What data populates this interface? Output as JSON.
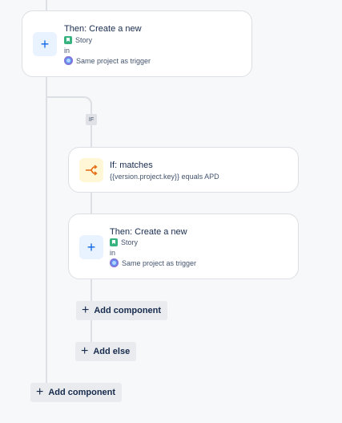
{
  "outer_then": {
    "title": "Then: Create a new",
    "issue_type": "Story",
    "in_label": "in",
    "project": "Same project as trigger"
  },
  "if_tag": "IF",
  "if_condition": {
    "title": "If: matches",
    "detail": "{{version.project.key}} equals APD"
  },
  "inner_then": {
    "title": "Then: Create a new",
    "issue_type": "Story",
    "in_label": "in",
    "project": "Same project as trigger"
  },
  "buttons": {
    "add_component_inner": "Add component",
    "add_else": "Add else",
    "add_component_outer": "Add component"
  },
  "colors": {
    "accent_blue": "#0c66e4",
    "branch_orange": "#e56910",
    "story_green": "#36b37e"
  }
}
